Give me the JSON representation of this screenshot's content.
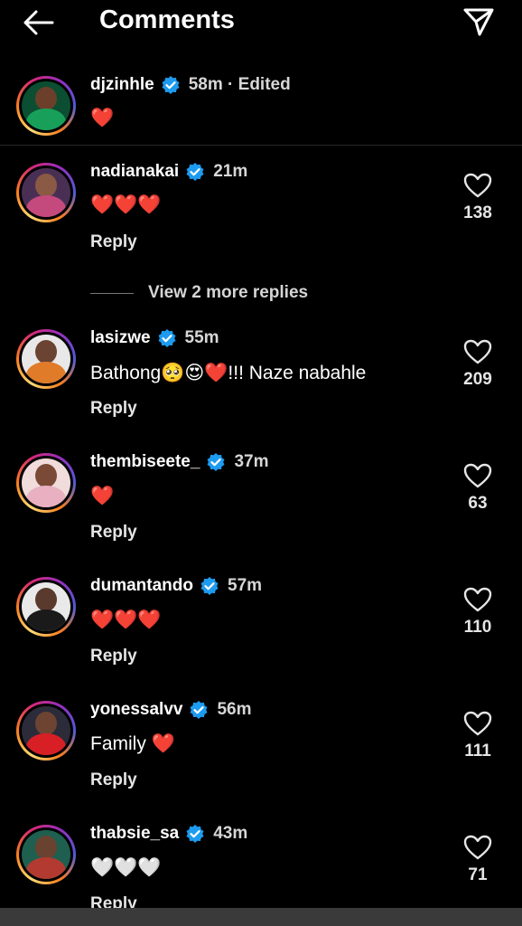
{
  "header": {
    "title": "Comments",
    "back_icon": "back-arrow-icon",
    "send_icon": "paper-plane-icon"
  },
  "caption": {
    "username": "djzinhle",
    "time": "58m · Edited",
    "text": "❤️"
  },
  "view_more": "View 2 more replies",
  "reply_label": "Reply",
  "comments": [
    {
      "username": "nadianakai",
      "time": "21m",
      "text": "❤️❤️❤️",
      "likes": "138"
    },
    {
      "username": "lasizwe",
      "time": "55m",
      "text": "Bathong🥺😍❤️!!! Naze nabahle",
      "likes": "209"
    },
    {
      "username": "thembiseete_",
      "time": "37m",
      "text": "❤️",
      "likes": "63"
    },
    {
      "username": "dumantando",
      "time": "57m",
      "text": "❤️❤️❤️",
      "likes": "110"
    },
    {
      "username": "yonessalvv",
      "time": "56m",
      "text": "Family ❤️",
      "likes": "111"
    },
    {
      "username": "thabsie_sa",
      "time": "43m",
      "text": "🤍🤍🤍",
      "likes": "71"
    }
  ],
  "colors": {
    "background": "#000000",
    "verified": "#1d9bf0",
    "heart": "#ed1c24"
  }
}
